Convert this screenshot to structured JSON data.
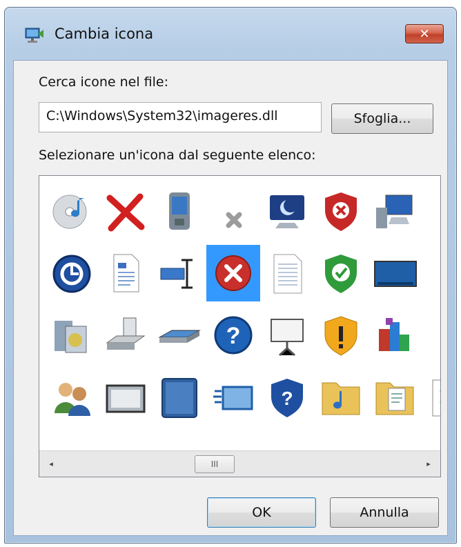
{
  "window": {
    "title": "Cambia icona",
    "close_label": "✕"
  },
  "file": {
    "label": "Cerca icone nel file:",
    "value": "C:\\Windows\\System32\\imageres.dll",
    "browse_label": "Sfoglia..."
  },
  "list": {
    "label": "Selezionare un'icona dal seguente elenco:",
    "selected_index": 11,
    "icons": [
      "cd-music-icon",
      "red-x-icon",
      "pda-device-icon",
      "gray-x-icon",
      "monitor-moon-icon",
      "red-shield-x-icon",
      "computer-network-icon",
      "folder-partial-icon",
      "restore-icon",
      "document-text-icon",
      "rename-cursor-icon",
      "error-icon",
      "notepad-icon",
      "green-shield-check-icon",
      "desktop-screen-icon",
      "gear-partial-icon",
      "media-tools-icon",
      "scanner-drive-icon",
      "flatbed-scanner-icon",
      "help-icon",
      "projector-screen-icon",
      "warning-shield-icon",
      "programs-chart-icon",
      "folder-partial-icon",
      "users-icon",
      "frame-icon",
      "tablet-icon",
      "speed-window-icon",
      "shield-help-icon",
      "music-folder-icon",
      "document-folder-icon",
      "green-arrows-icon"
    ],
    "scroll_thumb": "III",
    "scroll_left": "◂",
    "scroll_right": "▸"
  },
  "buttons": {
    "ok": "OK",
    "cancel": "Annulla"
  }
}
